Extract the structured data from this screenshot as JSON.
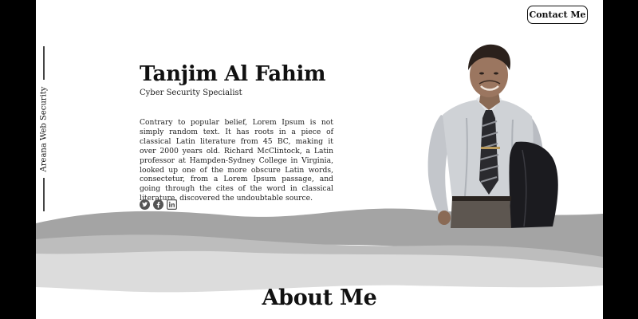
{
  "header": {
    "contact_label": "Contact Me"
  },
  "sidebar": {
    "vertical_text": "Areana Web Security"
  },
  "hero": {
    "name": "Tanjim Al Fahim",
    "role": "Cyber Security Specialist",
    "bio": "Contrary to popular belief, Lorem Ipsum is not simply random text. It has roots in a piece of classical Latin literature from 45 BC, making it over 2000 years old. Richard McClintock, a Latin professor at Hampden-Sydney College in Virginia, looked up one of the more obscure Latin words, consectetur, from a Lorem Ipsum passage, and going through the cites of the word in classical literature, discovered the undoubtable source."
  },
  "socials": {
    "items": [
      {
        "icon": "twitter-icon"
      },
      {
        "icon": "facebook-icon"
      },
      {
        "icon": "linkedin-icon"
      }
    ]
  },
  "about": {
    "title": "About Me"
  },
  "colors": {
    "background": "#ffffff",
    "frame": "#000000",
    "text": "#111111",
    "wave_dark": "#a4a4a4",
    "wave_mid": "#bdbdbd",
    "wave_light": "#dcdcdc"
  }
}
